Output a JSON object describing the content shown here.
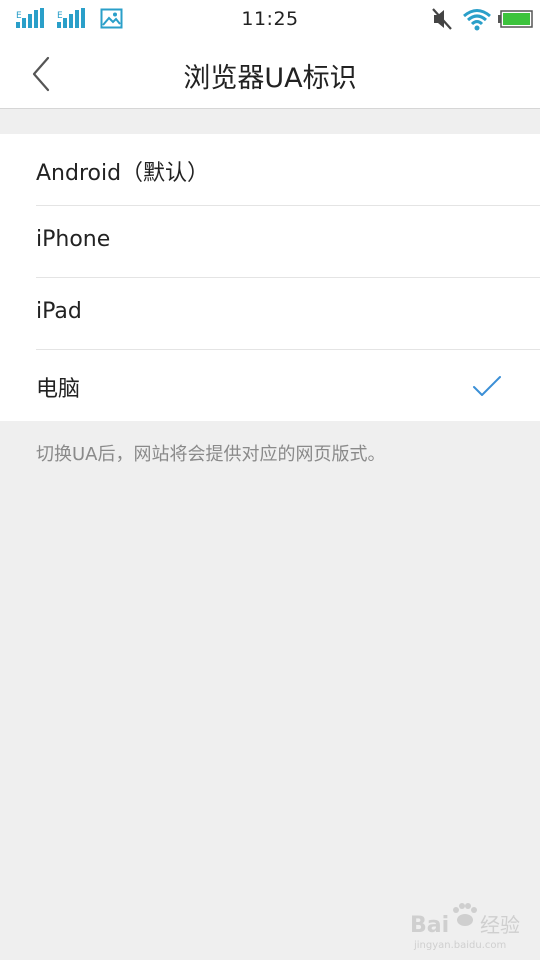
{
  "status_bar": {
    "time": "11:25",
    "icons": [
      "signal-1-icon",
      "signal-2-icon",
      "image-notification-icon",
      "mute-icon",
      "wifi-icon",
      "battery-icon"
    ]
  },
  "header": {
    "title": "浏览器UA标识",
    "back_icon": "chevron-left-icon"
  },
  "options": [
    {
      "label": "Android（默认）",
      "selected": false
    },
    {
      "label": "iPhone",
      "selected": false
    },
    {
      "label": "iPad",
      "selected": false
    },
    {
      "label": "电脑",
      "selected": true
    }
  ],
  "hint": "切换UA后，网站将会提供对应的网页版式。",
  "watermark": {
    "text": "Baidu经验",
    "sub": "jingyan.baidu.com"
  },
  "colors": {
    "accent": "#3b8fd6",
    "signal": "#2a9fc9",
    "battery": "#3cc33c",
    "background": "#efefef"
  }
}
